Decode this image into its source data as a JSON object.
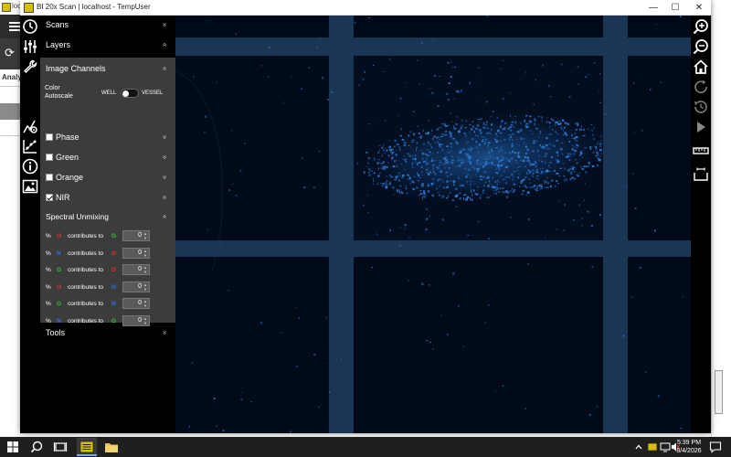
{
  "background_app": {
    "title_fragment": "loc",
    "tab_label_fragment": "Analy"
  },
  "window": {
    "title": "BI 20x Scan | localhost - TempUser",
    "minimize_glyph": "—",
    "maximize_glyph": "☐",
    "close_glyph": "✕"
  },
  "panel": {
    "scans": {
      "label": "Scans",
      "chevron": "»"
    },
    "layers": {
      "label": "Layers",
      "chevron": "«"
    },
    "image_channels": {
      "label": "Image Channels",
      "chevron": "«"
    },
    "collapse_glyph": "«",
    "autoscale": {
      "label": "Color Autoscale",
      "left_option": "WELL",
      "right_option": "VESSEL",
      "position": "WELL"
    },
    "channels": [
      {
        "label": "Phase",
        "checked": false,
        "chevron": "»"
      },
      {
        "label": "Green",
        "checked": false,
        "chevron": "»"
      },
      {
        "label": "Orange",
        "checked": false,
        "chevron": "»"
      },
      {
        "label": "NIR",
        "checked": true,
        "chevron": "»"
      }
    ],
    "spectral": {
      "label": "Spectral Unmixing",
      "chevron": "«",
      "percent_symbol": "%",
      "contributes_text": "contributes to",
      "rows": [
        {
          "from": "O",
          "from_color": "#e53030",
          "to": "G",
          "to_color": "#31c331",
          "value": "0"
        },
        {
          "from": "N",
          "from_color": "#2f6fe8",
          "to": "O",
          "to_color": "#e53030",
          "value": "0"
        },
        {
          "from": "G",
          "from_color": "#31c331",
          "to": "O",
          "to_color": "#e53030",
          "value": "0"
        },
        {
          "from": "O",
          "from_color": "#e53030",
          "to": "N",
          "to_color": "#2f6fe8",
          "value": "0"
        },
        {
          "from": "G",
          "from_color": "#31c331",
          "to": "N",
          "to_color": "#2f6fe8",
          "value": "0"
        },
        {
          "from": "N",
          "from_color": "#2f6fe8",
          "to": "G",
          "to_color": "#31c331",
          "value": "0"
        }
      ]
    },
    "tools": {
      "label": "Tools",
      "chevron": "»"
    }
  },
  "colors": {
    "accent_yellow": "#d4c000",
    "nir_signal": "#2f7dd6",
    "grid_line": "#1b3555",
    "panel_gray": "#3c3c3c"
  },
  "taskbar": {
    "time": "5:39 PM",
    "date": "8/4/2026"
  }
}
